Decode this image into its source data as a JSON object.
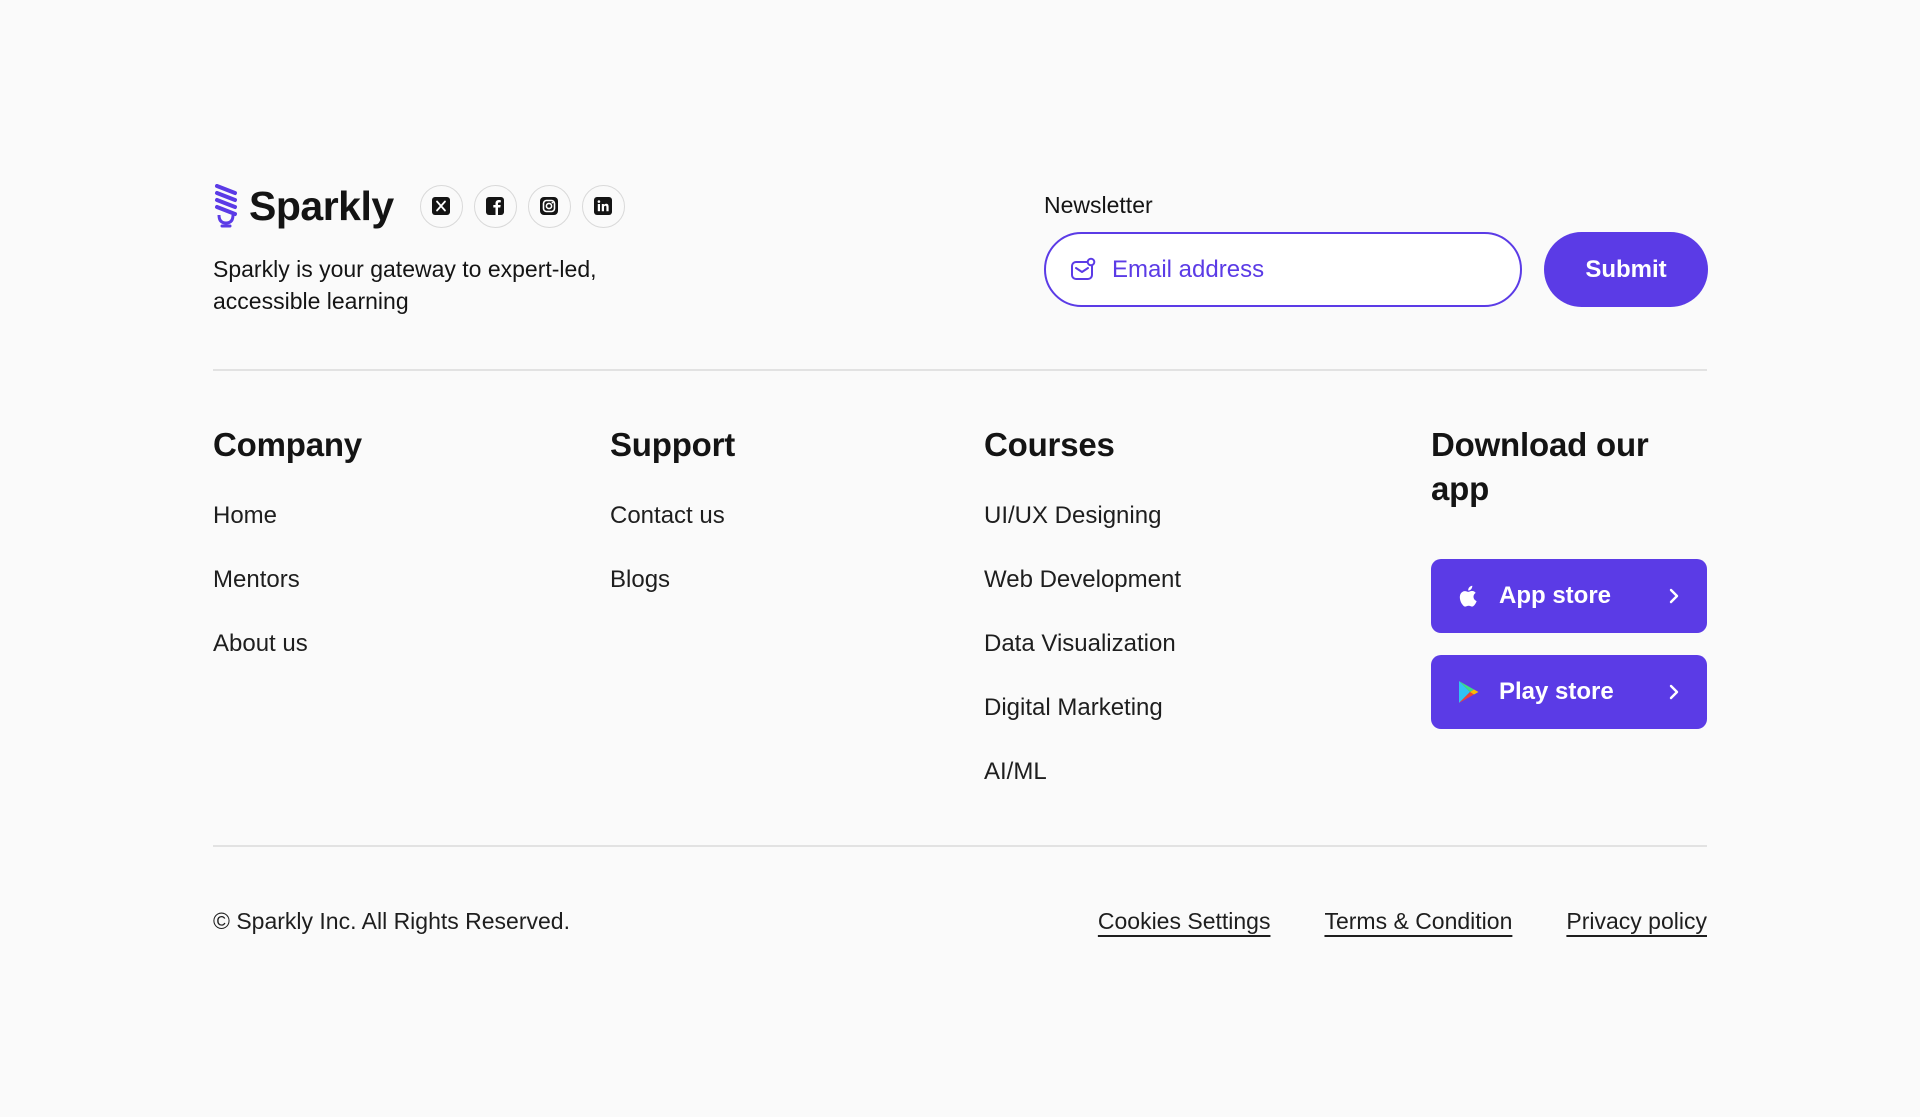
{
  "brand": {
    "name": "Sparkly",
    "tagline": "Sparkly is your gateway to expert-led, accessible learning",
    "accent_color": "#5B3BE6"
  },
  "socials": [
    {
      "icon": "x-twitter-icon"
    },
    {
      "icon": "facebook-icon"
    },
    {
      "icon": "instagram-icon"
    },
    {
      "icon": "linkedin-icon"
    }
  ],
  "newsletter": {
    "label": "Newsletter",
    "email_placeholder": "Email address",
    "email_value": "",
    "submit_label": "Submit"
  },
  "columns": {
    "company": {
      "title": "Company",
      "items": [
        "Home",
        "Mentors",
        "About us"
      ]
    },
    "support": {
      "title": "Support",
      "items": [
        "Contact us",
        "Blogs"
      ]
    },
    "courses": {
      "title": "Courses",
      "items": [
        "UI/UX Designing",
        "Web Development",
        "Data Visualization",
        "Digital Marketing",
        "AI/ML"
      ]
    },
    "app": {
      "title": "Download our app",
      "buttons": [
        {
          "label": "App store",
          "icon": "apple-icon"
        },
        {
          "label": "Play store",
          "icon": "google-play-icon"
        }
      ]
    }
  },
  "bottom": {
    "copyright": "© Sparkly Inc. All Rights Reserved.",
    "links": [
      "Cookies Settings",
      "Terms &  Condition",
      "Privacy policy"
    ]
  }
}
